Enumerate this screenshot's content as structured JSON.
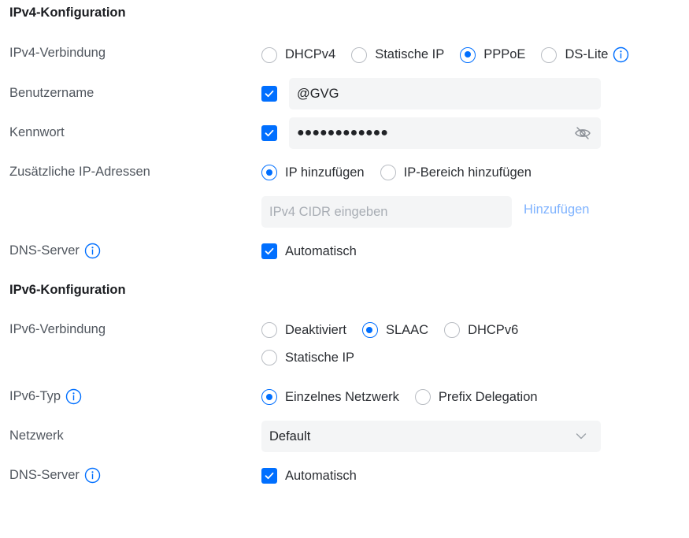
{
  "ipv4": {
    "title": "IPv4-Konfiguration",
    "connection": {
      "label": "IPv4-Verbindung",
      "options": [
        "DHCPv4",
        "Statische IP",
        "PPPoE",
        "DS-Lite"
      ],
      "selected": "PPPoE"
    },
    "username": {
      "label": "Benutzername",
      "value": "@GVG"
    },
    "password": {
      "label": "Kennwort",
      "value": "●●●●●●●●●●●●"
    },
    "extra_ips": {
      "label": "Zusätzliche IP-Adressen",
      "options": [
        "IP hinzufügen",
        "IP-Bereich hinzufügen"
      ],
      "selected": "IP hinzufügen",
      "placeholder": "IPv4 CIDR eingeben",
      "add_label": "Hinzufügen"
    },
    "dns": {
      "label": "DNS-Server",
      "auto_label": "Automatisch"
    }
  },
  "ipv6": {
    "title": "IPv6-Konfiguration",
    "connection": {
      "label": "IPv6-Verbindung",
      "options": [
        "Deaktiviert",
        "SLAAC",
        "DHCPv6",
        "Statische IP"
      ],
      "selected": "SLAAC"
    },
    "type": {
      "label": "IPv6-Typ",
      "options": [
        "Einzelnes Netzwerk",
        "Prefix Delegation"
      ],
      "selected": "Einzelnes Netzwerk"
    },
    "network": {
      "label": "Netzwerk",
      "value": "Default"
    },
    "dns": {
      "label": "DNS-Server",
      "auto_label": "Automatisch"
    }
  },
  "colors": {
    "accent": "#006fff",
    "field_bg": "#f4f5f6",
    "link": "#7fb3ff"
  },
  "icons": [
    "info-icon",
    "checkmark-icon",
    "eye-off-icon",
    "chevron-down-icon"
  ]
}
